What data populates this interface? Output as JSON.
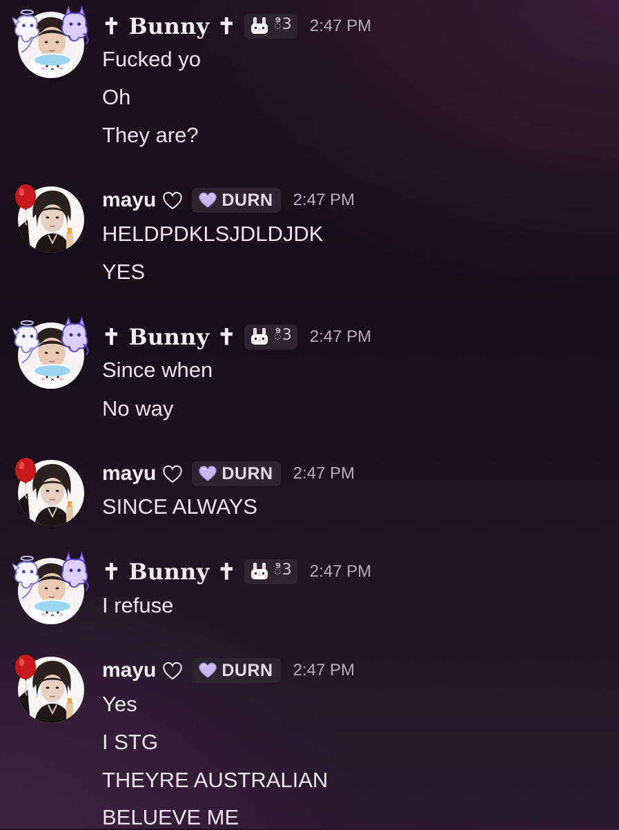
{
  "colors": {
    "background": "#171118",
    "text": "#ece4ee",
    "timestamp": "#b7aebb",
    "tag_background": "#2c2530",
    "durn_heart": "#c9b8f0",
    "balloon_red": "#c8181c",
    "bunny_icon_pink": "#f4a7c8"
  },
  "messages": [
    {
      "author": "✝ Bunny ✝",
      "tag": "ి3",
      "tag_icon": "bunny-face-icon",
      "time": "2:47 PM",
      "lines": [
        "Fucked yo",
        "Oh",
        "They are?"
      ]
    },
    {
      "author": "mayu",
      "tag": "DURN",
      "tag_icon": "purple-heart-icon",
      "time": "2:47 PM",
      "lines": [
        "HELDPDKLSJDLDJDK",
        "YES"
      ]
    },
    {
      "author": "✝ Bunny ✝",
      "tag": "ి3",
      "tag_icon": "bunny-face-icon",
      "time": "2:47 PM",
      "lines": [
        "Since when",
        "No way"
      ]
    },
    {
      "author": "mayu",
      "tag": "DURN",
      "tag_icon": "purple-heart-icon",
      "time": "2:47 PM",
      "lines": [
        "SINCE ALWAYS"
      ]
    },
    {
      "author": "✝ Bunny ✝",
      "tag": "ి3",
      "tag_icon": "bunny-face-icon",
      "time": "2:47 PM",
      "lines": [
        "I refuse"
      ]
    },
    {
      "author": "mayu",
      "tag": "DURN",
      "tag_icon": "purple-heart-icon",
      "time": "2:47 PM",
      "lines": [
        "Yes",
        "I STG",
        "THEYRE AUSTRALIAN",
        "BELUEVE ME"
      ]
    }
  ]
}
